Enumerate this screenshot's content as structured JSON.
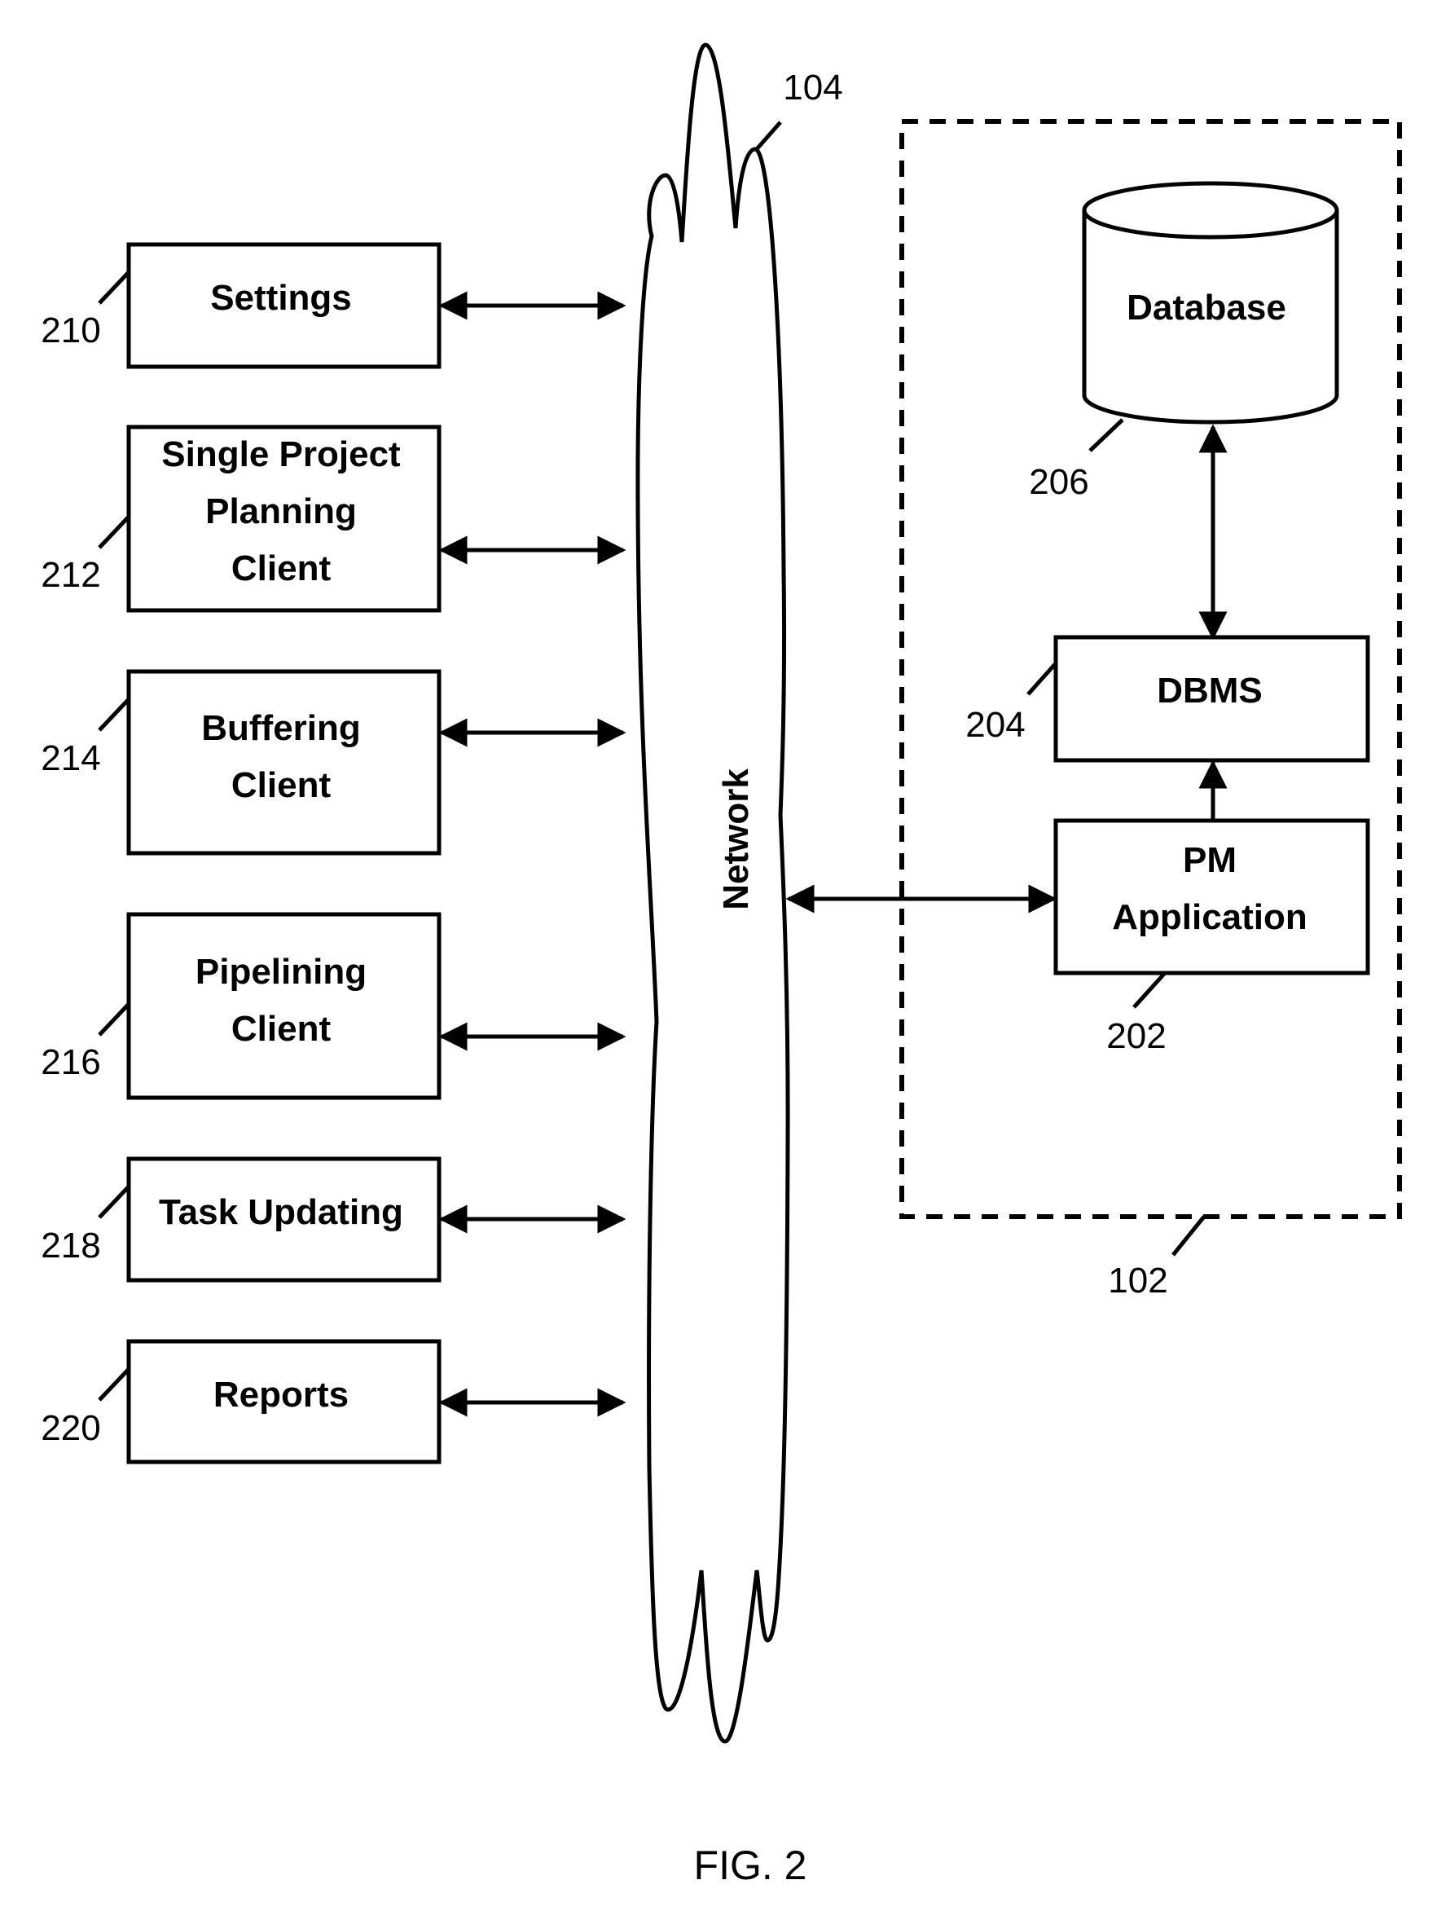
{
  "figure": {
    "caption": "FIG. 2",
    "network": {
      "label": "Network",
      "ref": "104"
    },
    "server_group": {
      "ref": "102"
    },
    "clients": [
      {
        "lines": [
          "Settings"
        ],
        "ref": "210"
      },
      {
        "lines": [
          "Single Project",
          "Planning",
          "Client"
        ],
        "ref": "212"
      },
      {
        "lines": [
          "Buffering",
          "Client"
        ],
        "ref": "214"
      },
      {
        "lines": [
          "Pipelining",
          "Client"
        ],
        "ref": "216"
      },
      {
        "lines": [
          "Task Updating"
        ],
        "ref": "218"
      },
      {
        "lines": [
          "Reports"
        ],
        "ref": "220"
      }
    ],
    "database": {
      "label": "Database",
      "ref": "206"
    },
    "dbms": {
      "label": "DBMS",
      "ref": "204"
    },
    "pm_application": {
      "lines": [
        "PM",
        "Application"
      ],
      "ref": "202"
    },
    "connections": [
      {
        "from": "Settings",
        "to": "Network",
        "direction": "bidirectional"
      },
      {
        "from": "Single Project Planning Client",
        "to": "Network",
        "direction": "bidirectional"
      },
      {
        "from": "Buffering Client",
        "to": "Network",
        "direction": "bidirectional"
      },
      {
        "from": "Pipelining Client",
        "to": "Network",
        "direction": "bidirectional"
      },
      {
        "from": "Task Updating",
        "to": "Network",
        "direction": "bidirectional"
      },
      {
        "from": "Reports",
        "to": "Network",
        "direction": "bidirectional"
      },
      {
        "from": "Network",
        "to": "PM Application",
        "direction": "bidirectional"
      },
      {
        "from": "PM Application",
        "to": "DBMS",
        "direction": "one-way"
      },
      {
        "from": "DBMS",
        "to": "Database",
        "direction": "bidirectional"
      }
    ]
  }
}
